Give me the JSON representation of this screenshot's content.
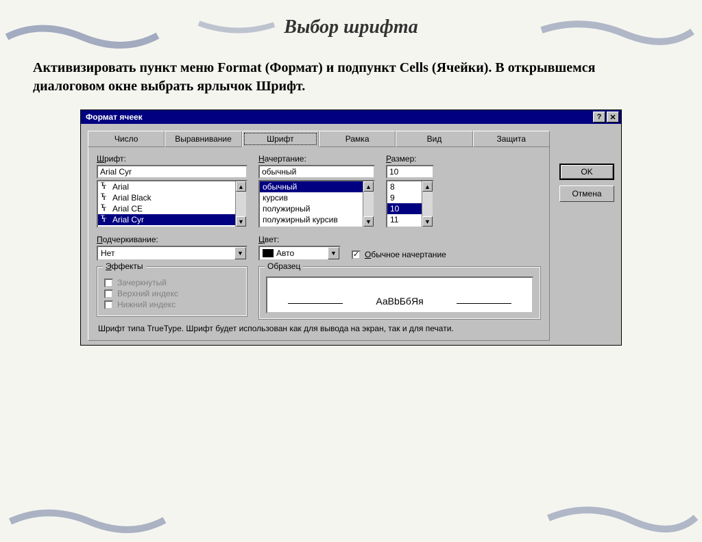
{
  "slide": {
    "title": "Выбор шрифта",
    "paragraph": "Активизировать пункт меню Format (Формат) и подпункт Cells (Ячейки). В открывшемся диалоговом окне выбрать ярлычок Шрифт."
  },
  "dialog": {
    "title": "Формат ячеек",
    "tabs": [
      "Число",
      "Выравнивание",
      "Шрифт",
      "Рамка",
      "Вид",
      "Защита"
    ],
    "active_tab": "Шрифт",
    "labels": {
      "font": "Шрифт:",
      "style": "Начертание:",
      "size": "Размер:",
      "underline": "Подчеркивание:",
      "color": "Цвет:",
      "effects": "Эффекты",
      "sample": "Образец"
    },
    "font": {
      "value": "Arial Cyr",
      "options": [
        "Arial",
        "Arial Black",
        "Arial CE",
        "Arial Cyr"
      ],
      "selected": "Arial Cyr"
    },
    "style": {
      "value": "обычный",
      "options": [
        "обычный",
        "курсив",
        "полужирный",
        "полужирный курсив"
      ],
      "selected": "обычный"
    },
    "size": {
      "value": "10",
      "options": [
        "8",
        "9",
        "10",
        "11"
      ],
      "selected": "10"
    },
    "underline": {
      "value": "Нет"
    },
    "color": {
      "value": "Авто"
    },
    "normal_font_checkbox": {
      "checked": true,
      "label": "Обычное начертание"
    },
    "effects": {
      "strike": {
        "checked": false,
        "label": "Зачеркнутый"
      },
      "super": {
        "checked": false,
        "label": "Верхний индекс"
      },
      "sub": {
        "checked": false,
        "label": "Нижний индекс"
      }
    },
    "sample_text": "АаВbБбЯя",
    "hint": "Шрифт типа TrueType. Шрифт будет использован как для вывода на экран, так и для печати.",
    "buttons": {
      "ok": "OK",
      "cancel": "Отмена"
    }
  }
}
